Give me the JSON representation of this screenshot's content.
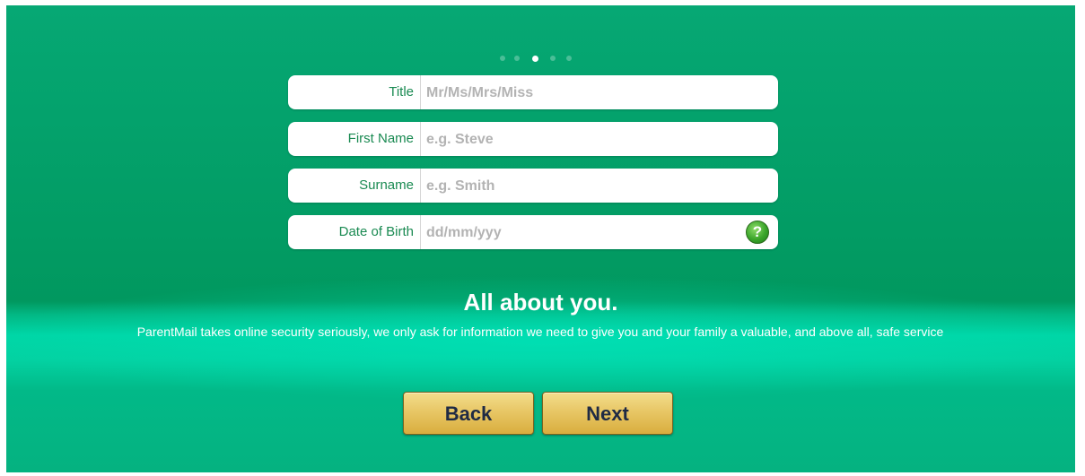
{
  "pager": {
    "total": 5,
    "active_index": 2
  },
  "form": {
    "fields": [
      {
        "label": "Title",
        "placeholder": "Mr/Ms/Mrs/Miss",
        "value": ""
      },
      {
        "label": "First Name",
        "placeholder": "e.g. Steve",
        "value": ""
      },
      {
        "label": "Surname",
        "placeholder": "e.g. Smith",
        "value": ""
      },
      {
        "label": "Date of Birth",
        "placeholder": "dd/mm/yyy",
        "value": ""
      }
    ],
    "help_icon": "question-icon",
    "help_glyph": "?"
  },
  "headline": "All about you.",
  "description": "ParentMail takes online security seriously, we only ask for information we need to give you and your family a valuable, and above all, safe service",
  "buttons": {
    "back": "Back",
    "next": "Next"
  },
  "colors": {
    "background": "#01985f",
    "label_text": "#1a8a52",
    "button_gold": "#e8c766",
    "button_text": "#1f2a44"
  }
}
